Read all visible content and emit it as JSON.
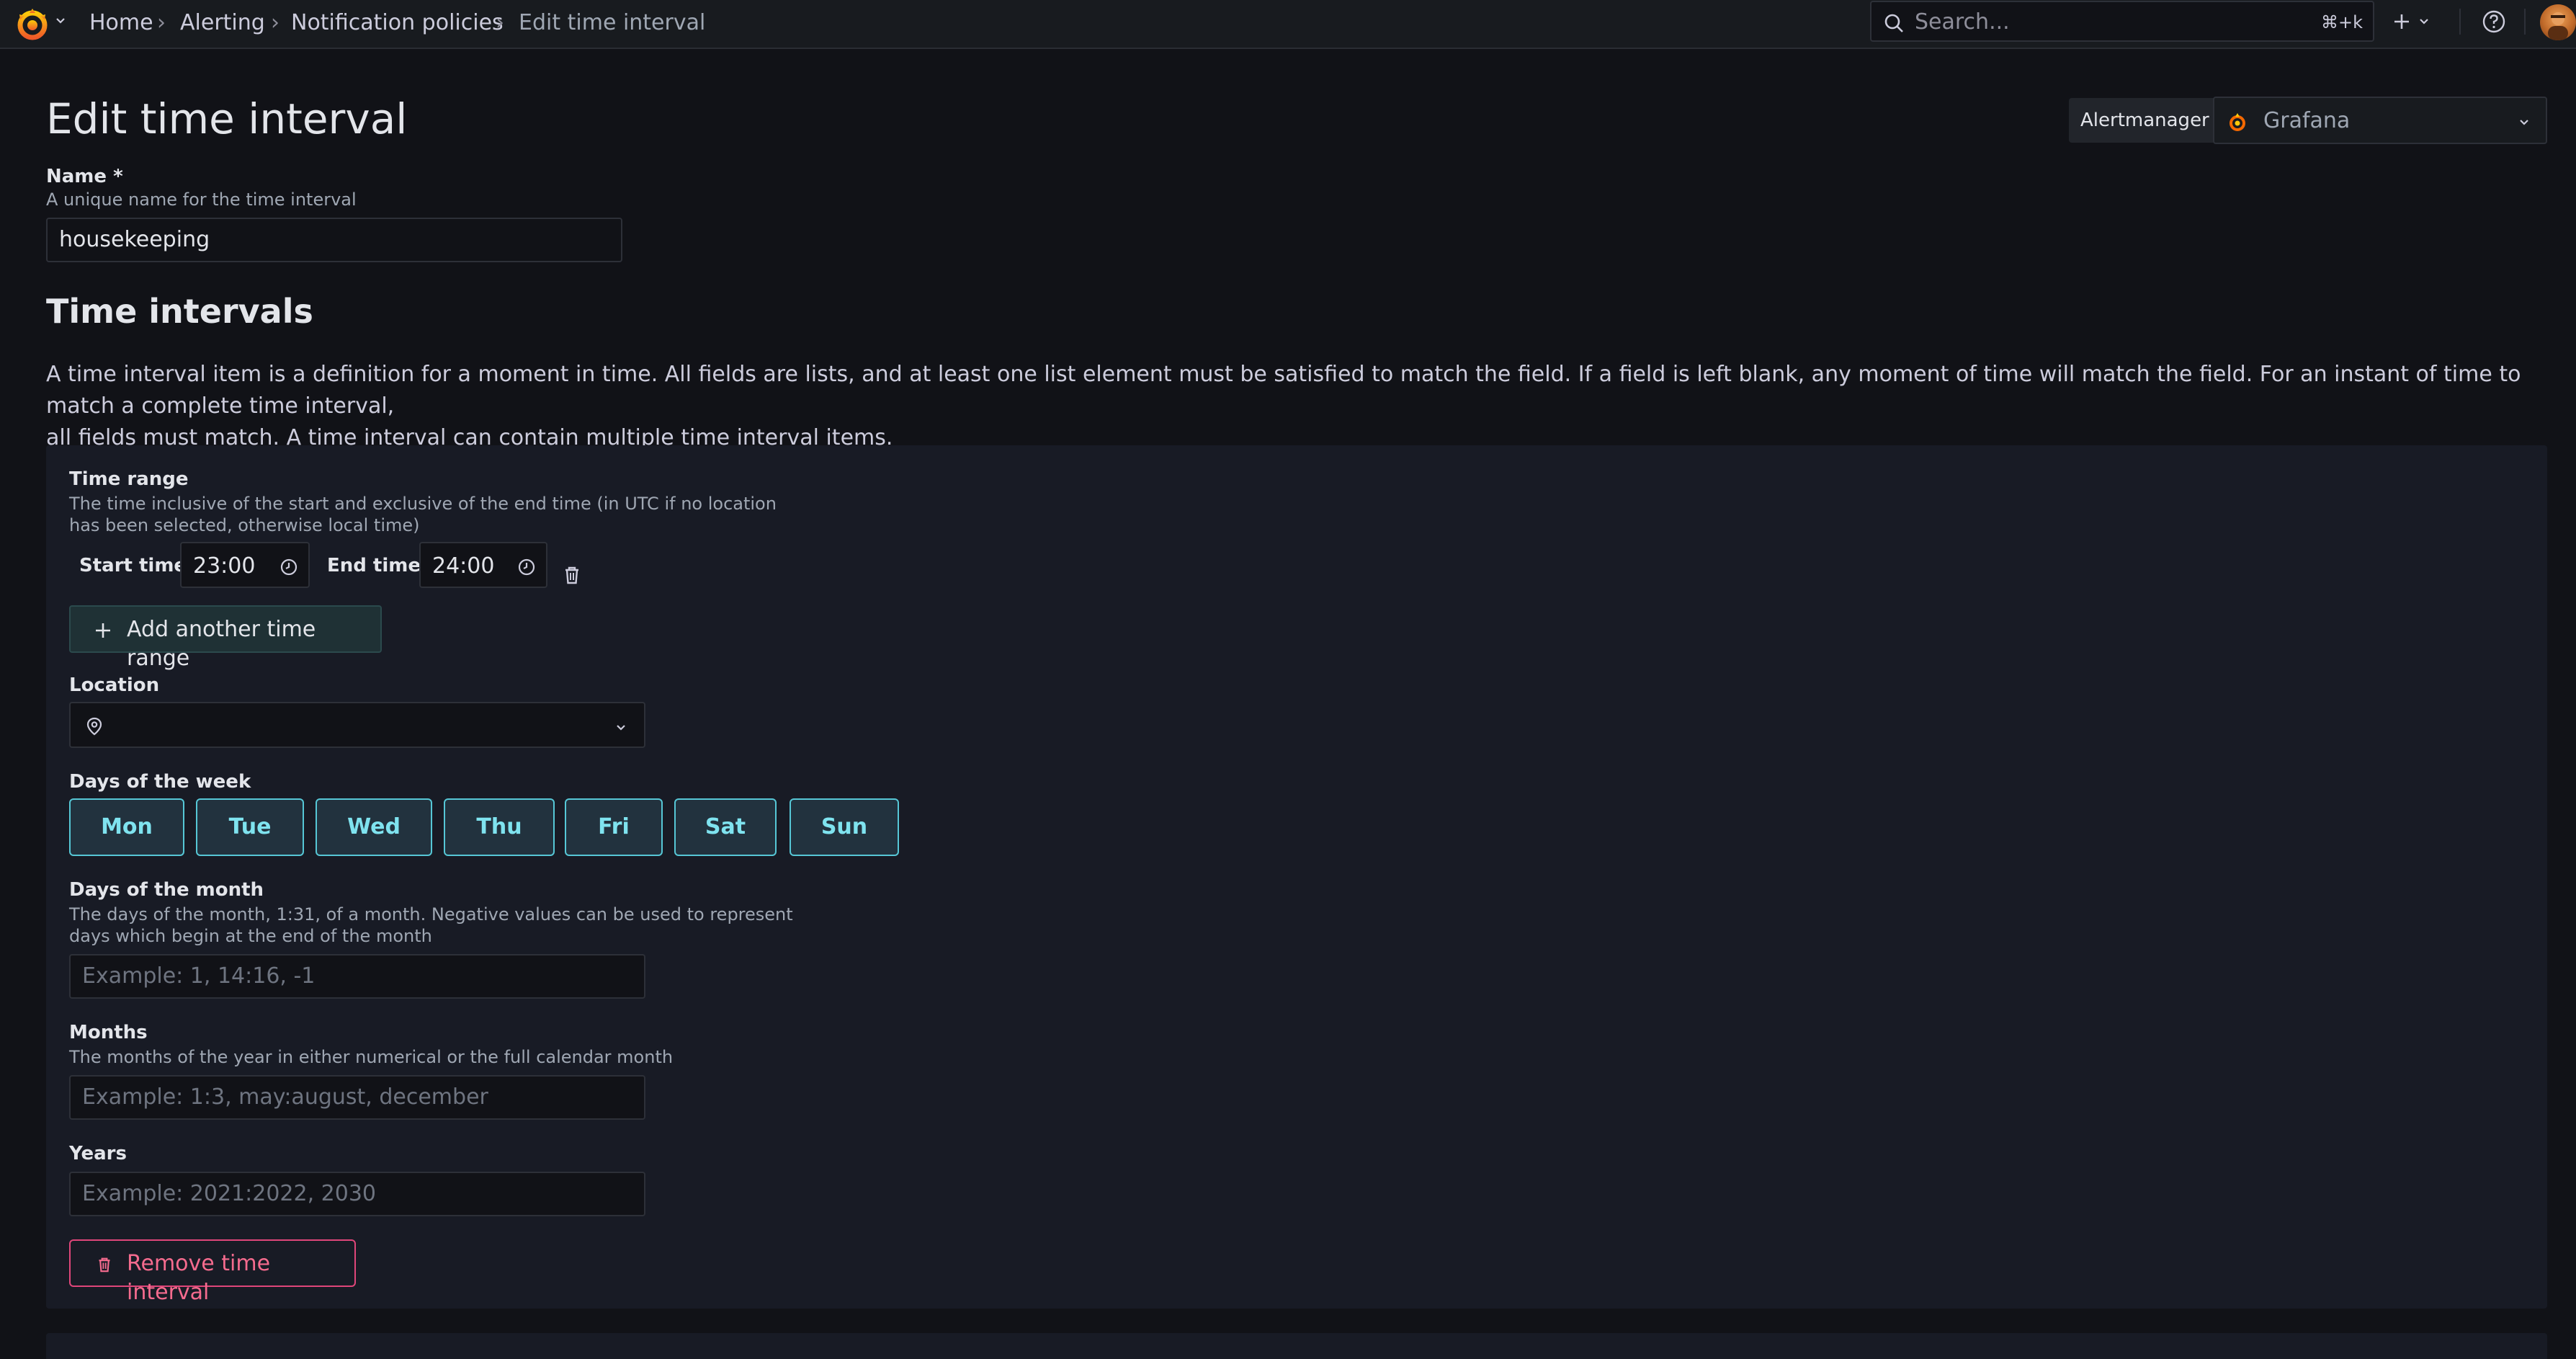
{
  "topbar": {
    "breadcrumbs": [
      "Home",
      "Alerting",
      "Notification policies",
      "Edit time interval"
    ],
    "search_placeholder": "Search...",
    "search_shortcut": "⌘+k"
  },
  "page": {
    "title": "Edit time interval",
    "alertmanager_label": "Alertmanager",
    "alertmanager_value": "Grafana"
  },
  "name_field": {
    "label": "Name *",
    "description": "A unique name for the time interval",
    "value": "housekeeping"
  },
  "time_intervals": {
    "title": "Time intervals",
    "description_line1": "A time interval item is a definition for a moment in time. All fields are lists, and at least one list element must be satisfied to match the field. If a field is left blank, any moment of time will match the field. For an instant of time to match a complete time interval,",
    "description_line2": "all fields must match. A time interval can contain multiple time interval items."
  },
  "time_range": {
    "label": "Time range",
    "description_line1": "The time inclusive of the start and exclusive of the end time (in UTC if no location",
    "description_line2": "has been selected, otherwise local time)",
    "start_label": "Start time",
    "start_value": "23:00",
    "end_label": "End time",
    "end_value": "24:00",
    "add_button": "Add another time range"
  },
  "location": {
    "label": "Location",
    "value": ""
  },
  "days_of_week": {
    "label": "Days of the week",
    "days": [
      "Mon",
      "Tue",
      "Wed",
      "Thu",
      "Fri",
      "Sat",
      "Sun"
    ]
  },
  "days_of_month": {
    "label": "Days of the month",
    "description_line1": "The days of the month, 1:31, of a month. Negative values can be used to represent",
    "description_line2": "days which begin at the end of the month",
    "placeholder": "Example: 1, 14:16, -1"
  },
  "months": {
    "label": "Months",
    "description": "The months of the year in either numerical or the full calendar month",
    "placeholder": "Example: 1:3, may:august, december"
  },
  "years": {
    "label": "Years",
    "placeholder": "Example: 2021:2022, 2030"
  },
  "remove_button": "Remove time interval",
  "colors": {
    "background": "#111217",
    "panel": "#181b25",
    "day_border": "#56c7d6",
    "danger": "#e0467a",
    "grafana_orange": "#f46800"
  }
}
